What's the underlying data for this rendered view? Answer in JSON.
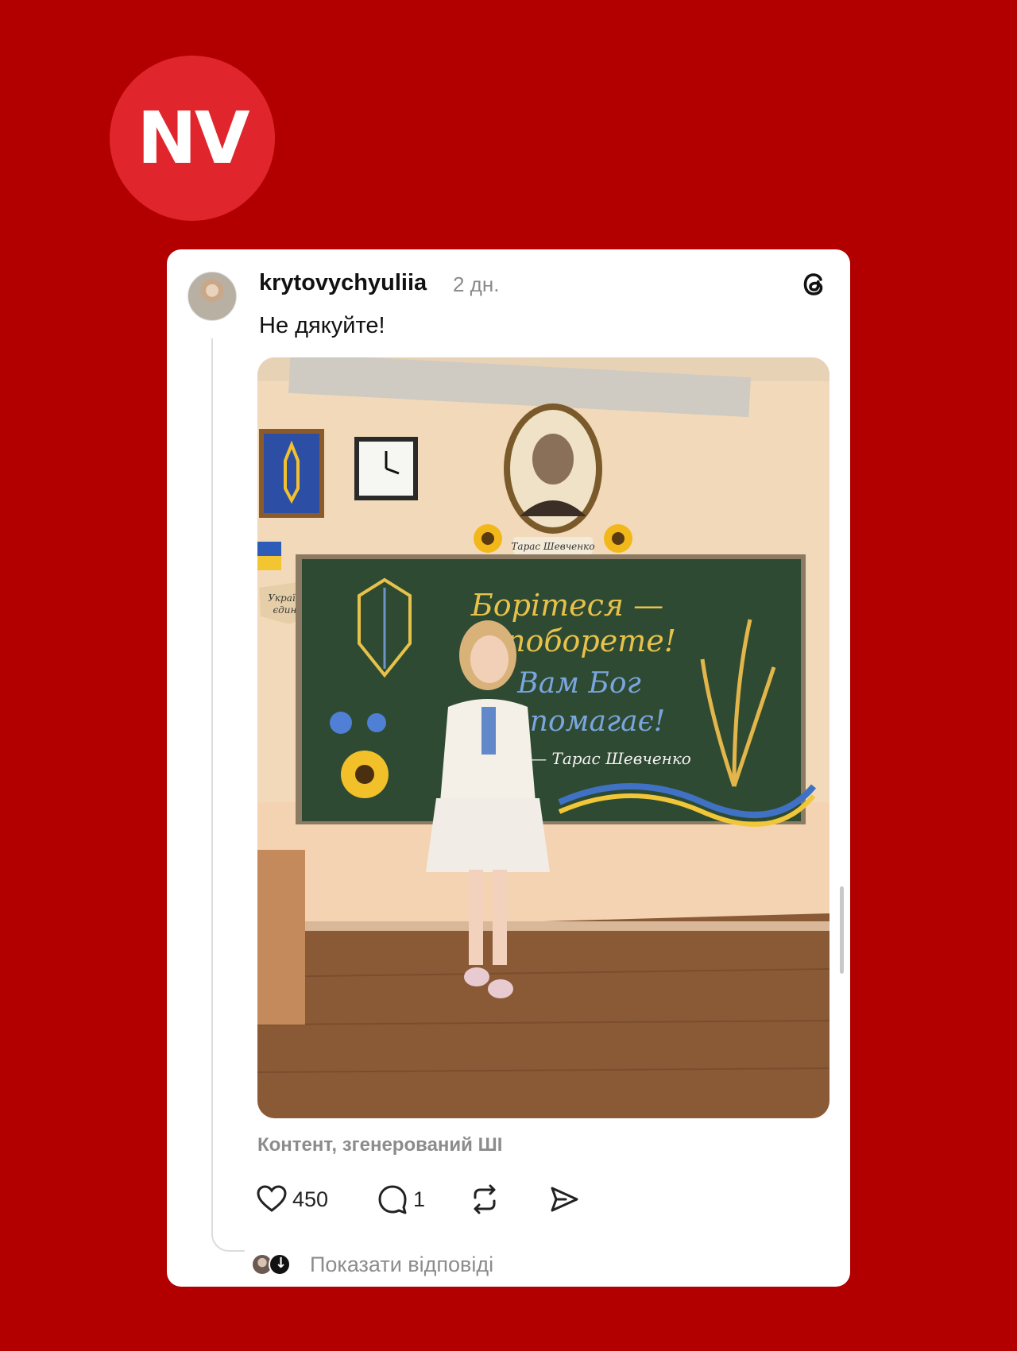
{
  "brand": {
    "logo_text": "NV",
    "background_color": "#b20000",
    "logo_color": "#e0262c"
  },
  "post": {
    "username": "krytovychyuliia",
    "time": "2 дн.",
    "text": "Не дякуйте!",
    "ai_label": "Контент, згенерований ШІ",
    "platform_icon": "threads-icon",
    "image": {
      "board_lines": [
        "Борітеся —",
        "поборете!",
        "Вам Бог",
        "помагає!",
        "— Тарас Шевченко"
      ],
      "portrait_caption": "Тарас Шевченко",
      "map_text": [
        "Україна",
        "єдина"
      ]
    }
  },
  "actions": {
    "likes": "450",
    "comments": "1",
    "icons": [
      "heart-icon",
      "comment-icon",
      "repost-icon",
      "share-icon"
    ]
  },
  "replies": {
    "label": "Показати відповіді"
  }
}
